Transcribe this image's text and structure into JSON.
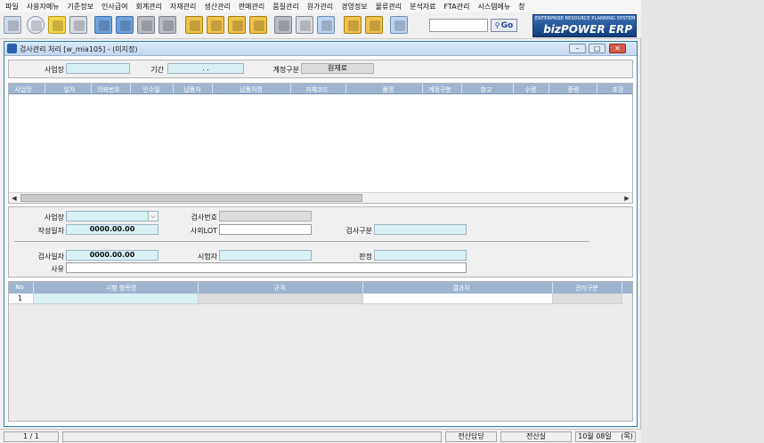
{
  "menu": [
    "파일",
    "사용자메뉴",
    "기준정보",
    "인사급여",
    "회계관리",
    "자재관리",
    "생산관리",
    "판매관리",
    "품질관리",
    "원가관리",
    "경영정보",
    "물류관리",
    "분석자료",
    "FTA관리",
    "시스템메뉴",
    "창"
  ],
  "toolbar": {
    "icons": [
      "document-icon",
      "eye-icon",
      "new-icon",
      "print-preview-icon",
      "edit-icon",
      "edit-alt-icon",
      "delete-icon",
      "trash-icon",
      "first-icon",
      "prev-icon",
      "next-icon",
      "last-icon",
      "database-icon",
      "export-icon",
      "tools-icon",
      "download-icon",
      "sign-icon",
      "exit-icon"
    ],
    "search_value": "",
    "go_label": "Go"
  },
  "logo": {
    "sub": "ENTERPRISE RESOURCE PLANNING SYSTEM",
    "main": "bizPOWER ERP"
  },
  "window": {
    "title": "검사관리 처리 [w_mia105] - (미지정)"
  },
  "filter": {
    "site_label": "사업장",
    "site_value": "",
    "period_label": "기간",
    "period_value": ". .",
    "account_type_label": "계정구분",
    "account_type_value": "원재료"
  },
  "grid1": {
    "columns": [
      "사업장",
      "일자",
      "의뢰번호",
      "인수일",
      "납품처",
      "납품처명",
      "자재코드",
      "품명",
      "계정구분",
      "창고",
      "수량",
      "중량",
      "표장"
    ]
  },
  "detail": {
    "site_label": "사업장",
    "site_value": "",
    "inspect_no_label": "검사번호",
    "inspect_no_value": "",
    "created_date_label": "작성일자",
    "created_date_value": "0000.00.00",
    "lot_label": "사외LOT",
    "lot_value": "",
    "inspect_type_label": "검사구분",
    "inspect_type_value": "",
    "inspect_date_label": "검사일자",
    "inspect_date_value": "0000.00.00",
    "tester_label": "시험자",
    "tester_value": "",
    "judgment_label": "판정",
    "judgment_value": "",
    "reason_label": "사유",
    "reason_value": ""
  },
  "grid2": {
    "columns": [
      "No",
      "시험 항목명",
      "규격",
      "결과치",
      "관리구분"
    ],
    "rows": [
      {
        "no": "1",
        "item": "",
        "spec": "",
        "result": "",
        "mgmt": ""
      }
    ]
  },
  "status": {
    "page": "1 / 1",
    "message": "",
    "dept": "전산담당",
    "room": "전산실",
    "date": "10월 08일",
    "weekday": "(목)"
  }
}
